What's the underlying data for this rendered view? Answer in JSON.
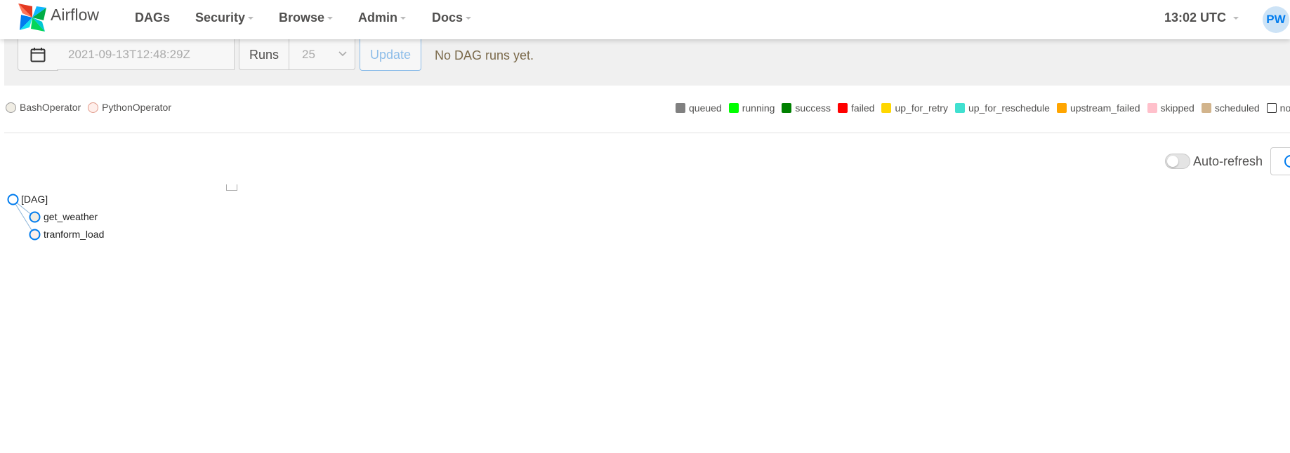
{
  "navbar": {
    "brand": "Airflow",
    "items": [
      {
        "label": "DAGs",
        "dropdown": false
      },
      {
        "label": "Security",
        "dropdown": true
      },
      {
        "label": "Browse",
        "dropdown": true
      },
      {
        "label": "Admin",
        "dropdown": true
      },
      {
        "label": "Docs",
        "dropdown": true
      }
    ],
    "clock": "13:02 UTC",
    "avatar": "PW"
  },
  "filters": {
    "base_date": "2021-09-13T12:48:29Z",
    "runs_label": "Runs",
    "runs_value": "25",
    "update_label": "Update",
    "status_message": "No DAG runs yet."
  },
  "operators": [
    {
      "label": "BashOperator",
      "color": "#f0ede4"
    },
    {
      "label": "PythonOperator",
      "color": "#ffefeb"
    }
  ],
  "states": [
    {
      "label": "queued",
      "color": "#808080"
    },
    {
      "label": "running",
      "color": "#00ff00"
    },
    {
      "label": "success",
      "color": "#008000"
    },
    {
      "label": "failed",
      "color": "#ff0000"
    },
    {
      "label": "up_for_retry",
      "color": "#ffd700"
    },
    {
      "label": "up_for_reschedule",
      "color": "#40e0d0"
    },
    {
      "label": "upstream_failed",
      "color": "#ffa500"
    },
    {
      "label": "skipped",
      "color": "#ffc0cb"
    },
    {
      "label": "scheduled",
      "color": "#d2b48c"
    },
    {
      "label": "no_s",
      "color": "#ffffff"
    }
  ],
  "auto_refresh": {
    "label": "Auto-refresh",
    "enabled": false
  },
  "tree": {
    "root": "[DAG]",
    "tasks": [
      "get_weather",
      "tranform_load"
    ]
  },
  "colors": {
    "accent": "#017cee",
    "text": "#51504f",
    "filter_bg": "#f0f0f0"
  }
}
